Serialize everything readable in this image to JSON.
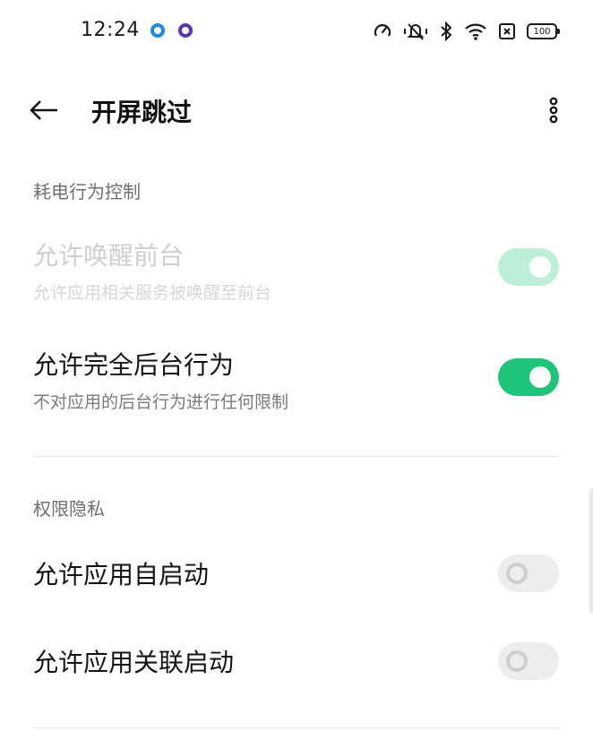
{
  "status_bar": {
    "time": "12:24",
    "battery": "100",
    "icons": [
      "sync-speed-icon",
      "mute-vibrate-icon",
      "bluetooth-icon",
      "wifi-icon",
      "sim-off-icon",
      "battery-icon"
    ]
  },
  "app_bar": {
    "title": "开屏跳过",
    "back_icon": "back-arrow-icon",
    "more_icon": "more-vertical-icon"
  },
  "sections": {
    "power": {
      "header": "耗电行为控制",
      "items": [
        {
          "title": "允许唤醒前台",
          "subtitle": "允许应用相关服务被唤醒至前台",
          "enabled": true,
          "disabled": true
        },
        {
          "title": "允许完全后台行为",
          "subtitle": "不对应用的后台行为进行任何限制",
          "enabled": true,
          "disabled": false
        }
      ]
    },
    "privacy": {
      "header": "权限隐私",
      "items": [
        {
          "title": "允许应用自启动",
          "enabled": false,
          "disabled": true
        },
        {
          "title": "允许应用关联启动",
          "enabled": false,
          "disabled": true
        }
      ]
    }
  },
  "colors": {
    "accent": "#1ec47a",
    "accent_dim": "#bdeed6",
    "toggle_off": "#ededed"
  }
}
